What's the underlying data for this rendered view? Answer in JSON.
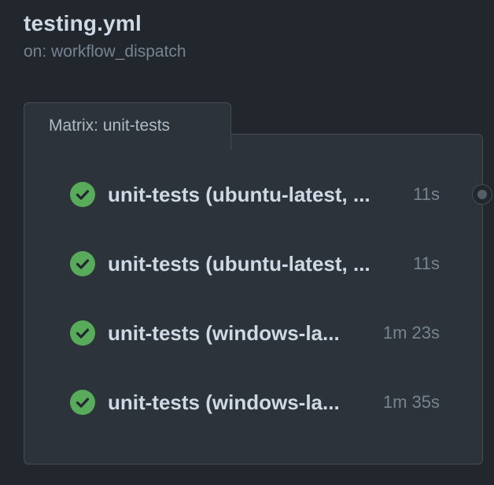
{
  "workflow": {
    "title": "testing.yml",
    "trigger": "on: workflow_dispatch"
  },
  "matrix": {
    "label": "Matrix: unit-tests",
    "jobs": [
      {
        "name": "unit-tests (ubuntu-latest, ...",
        "duration": "11s",
        "status": "success",
        "icon": "check-circle-icon"
      },
      {
        "name": "unit-tests (ubuntu-latest, ...",
        "duration": "11s",
        "status": "success",
        "icon": "check-circle-icon"
      },
      {
        "name": "unit-tests (windows-la...",
        "duration": "1m 23s",
        "status": "success",
        "icon": "check-circle-icon"
      },
      {
        "name": "unit-tests (windows-la...",
        "duration": "1m 35s",
        "status": "success",
        "icon": "check-circle-icon"
      }
    ]
  },
  "colors": {
    "background": "#22272e",
    "card": "#2d333b",
    "border": "#444c56",
    "success": "#57ab5a",
    "text_primary": "#cdd9e5",
    "text_muted": "#768390"
  }
}
